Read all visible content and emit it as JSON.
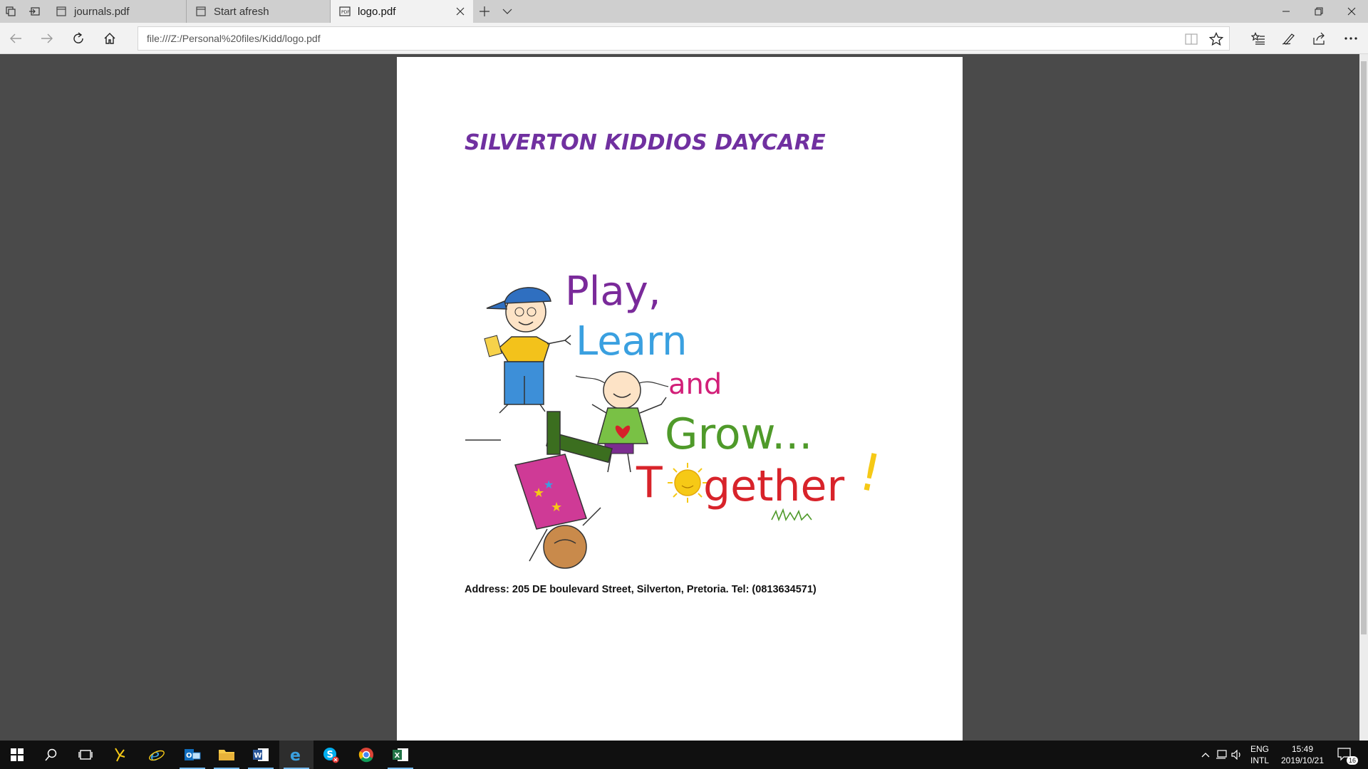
{
  "browser": {
    "tabs": [
      {
        "label": "journals.pdf",
        "icon": "page-icon",
        "active": false
      },
      {
        "label": "Start afresh",
        "icon": "page-icon",
        "active": false
      },
      {
        "label": "logo.pdf",
        "icon": "pdf-icon",
        "active": true
      }
    ],
    "address": "file:///Z:/Personal%20files/Kidd/logo.pdf"
  },
  "document": {
    "title": "SILVERTON KIDDIOS DAYCARE",
    "logo": {
      "line1": "Play,",
      "line2": "Learn",
      "line3": "and",
      "line4": "Grow...",
      "line5_start": "T",
      "line5_end": "gether",
      "line5_bang": "!"
    },
    "address": "Address: 205 DE boulevard Street, Silverton, Pretoria.  Tel: (0813634571)"
  },
  "taskbar": {
    "apps": [
      "windows-start-icon",
      "search-icon",
      "task-view-icon",
      "bird-app-icon",
      "internet-explorer-icon",
      "outlook-icon",
      "file-explorer-icon",
      "word-icon",
      "edge-icon",
      "skype-icon",
      "chrome-icon",
      "excel-icon"
    ],
    "language": "ENG",
    "keyboard": "INTL",
    "time": "15:49",
    "date": "2019/10/21",
    "notification_count": "16"
  },
  "colors": {
    "title_purple": "#7030a0",
    "play_purple": "#7a2a9a",
    "learn_blue": "#3aa0e0",
    "and_magenta": "#d21f78",
    "grow_green": "#4f9a2a",
    "together_red": "#d8232a",
    "sun_yellow": "#f6c916",
    "taskbar_accent": "#76b9ed"
  }
}
